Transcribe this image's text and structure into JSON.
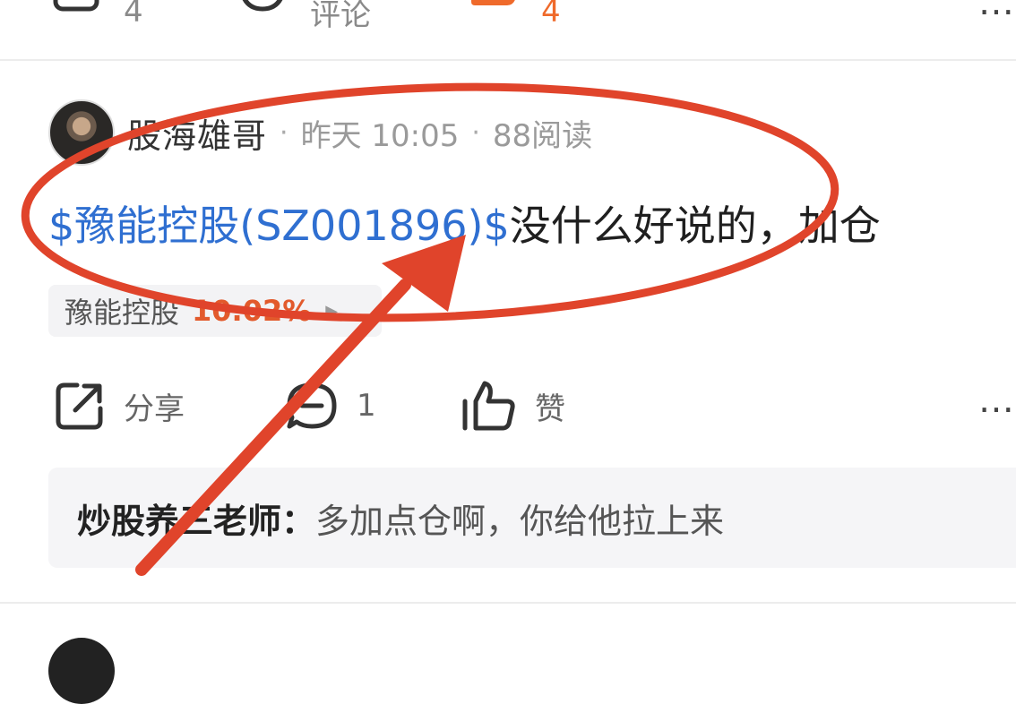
{
  "top_bar": {
    "share_count": "4",
    "comment_label": "评论",
    "like_count": "4"
  },
  "post": {
    "author": "股海雄哥",
    "time": "昨天 10:05",
    "reads": "88阅读",
    "stock_link": "$豫能控股(SZ001896)$",
    "text": "没什么好说的，加仓",
    "chip": {
      "name": "豫能控股",
      "percent": "10.02%"
    },
    "actions": {
      "share_label": "分享",
      "comment_count": "1",
      "like_label": "赞"
    },
    "comment": {
      "author": "炒股养三老师：",
      "text": "多加点仓啊，你给他拉上来"
    }
  },
  "colors": {
    "accent_orange": "#ef6a2b",
    "link_blue": "#2f6fd1",
    "annotation_red": "#e0442b"
  },
  "icons": {
    "more": "⋯"
  }
}
